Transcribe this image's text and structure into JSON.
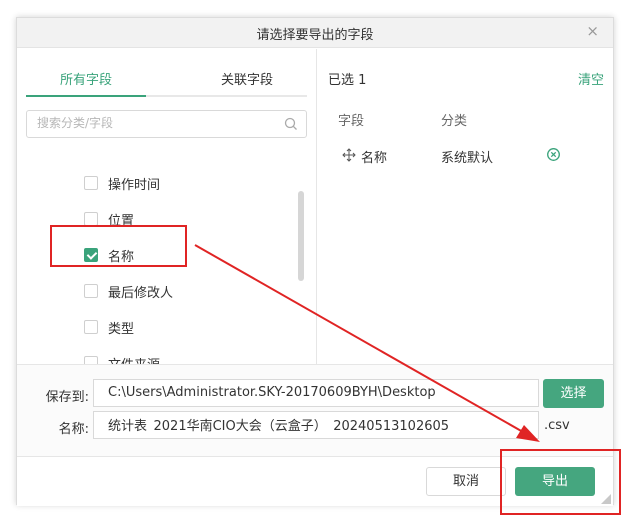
{
  "dialog": {
    "title": "请选择要导出的字段",
    "close_glyph": "×"
  },
  "tabs": [
    {
      "label": "所有字段",
      "active": true
    },
    {
      "label": "关联字段",
      "active": false
    }
  ],
  "search": {
    "placeholder": "搜索分类/字段"
  },
  "fields": [
    {
      "label": "操作时间",
      "checked": false
    },
    {
      "label": "位置",
      "checked": false
    },
    {
      "label": "名称",
      "checked": true
    },
    {
      "label": "最后修改人",
      "checked": false
    },
    {
      "label": "类型",
      "checked": false
    },
    {
      "label": "文件来源",
      "checked": false
    }
  ],
  "selected": {
    "count_label": "已选 1",
    "clear_label": "清空",
    "headers": {
      "field": "字段",
      "category": "分类"
    },
    "rows": [
      {
        "name": "名称",
        "category": "系统默认"
      }
    ]
  },
  "form": {
    "save_label": "保存到:",
    "save_path": "C:\\Users\\Administrator.SKY-20170609BYH\\Desktop",
    "choose_label": "选择",
    "name_label": "名称:",
    "name_value": "统计表_2021华南CIO大会（云盒子）_20240513102605",
    "extension": ".csv"
  },
  "footer": {
    "cancel_label": "取消",
    "export_label": "导出"
  },
  "colors": {
    "accent": "#3aa37b",
    "button": "#45a67f",
    "annotation": "#e02424"
  }
}
